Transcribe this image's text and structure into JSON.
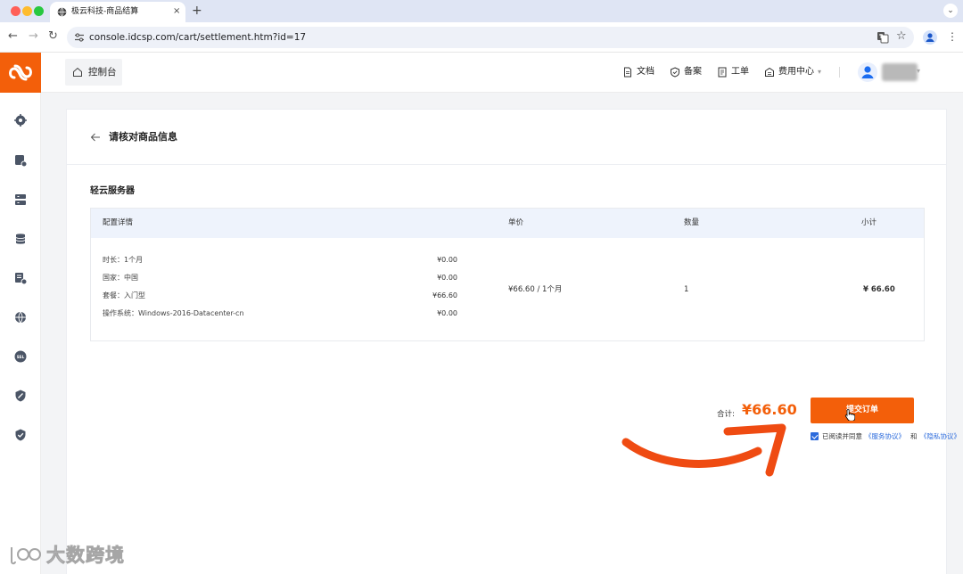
{
  "browser": {
    "tab_title": "极云科技-商品结算",
    "tab_close": "×",
    "new_tab": "+",
    "url": "console.idcsp.com/cart/settlement.htm?id=17"
  },
  "rail": {
    "items": [
      "dashboard-icon",
      "server-icon",
      "storage-icon",
      "database-icon",
      "domain-icon",
      "globe-icon",
      "ssl-icon",
      "security-icon",
      "shield-icon"
    ],
    "ssl_label": "SSL"
  },
  "header": {
    "console": "控制台",
    "docs": "文档",
    "record": "备案",
    "ticket": "工单",
    "billing": "费用中心",
    "billing_caret": "▾"
  },
  "page": {
    "title": "请核对商品信息",
    "section": "轻云服务器",
    "columns": {
      "config": "配置详情",
      "price": "单价",
      "qty": "数量",
      "subtotal": "小计"
    },
    "config_rows": [
      {
        "key": "时长：1个月",
        "value": "¥0.00"
      },
      {
        "key": "国家：中国",
        "value": "¥0.00"
      },
      {
        "key": "套餐：入门型",
        "value": "¥66.60"
      },
      {
        "key": "操作系统：Windows-2016-Datacenter-cn",
        "value": "¥0.00"
      }
    ],
    "unit_price": "¥66.60 / 1个月",
    "quantity": "1",
    "subtotal": "¥ 66.60"
  },
  "checkout": {
    "total_label": "合计:",
    "total_value": "¥66.60",
    "submit": "提交订单",
    "agreement_checked": true,
    "agree_text": "已阅读并同意",
    "service_link": "《服务协议》",
    "and": "和",
    "privacy_link": "《隐私协议》"
  },
  "watermark": {
    "text": "大数跨境"
  },
  "colors": {
    "brand": "#f35f0a",
    "link": "#2c6bdc",
    "table_head": "#eef3fc"
  }
}
